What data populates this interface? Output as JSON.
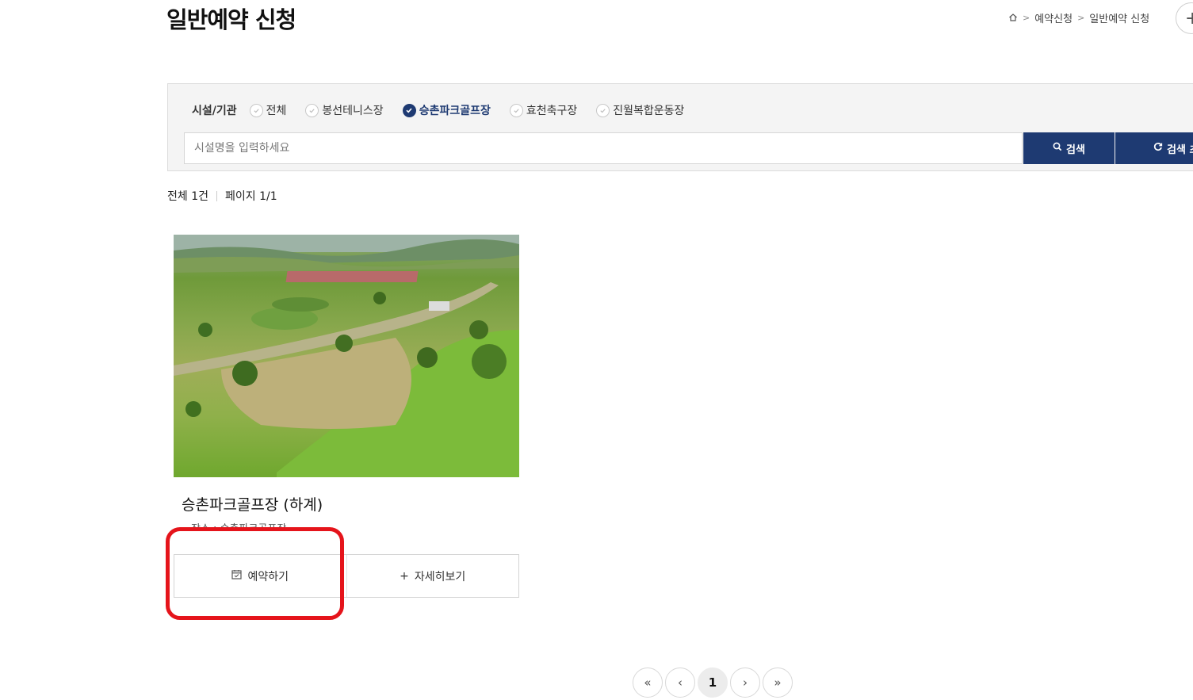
{
  "page": {
    "title": "일반예약 신청"
  },
  "breadcrumb": {
    "home_icon": "home-icon",
    "items": [
      "예약신청",
      "일반예약 신청"
    ],
    "separator": ">"
  },
  "header_action": {
    "icon": "plus-icon",
    "glyph": "+"
  },
  "filter": {
    "label": "시설/기관",
    "options": [
      "전체",
      "봉선테니스장",
      "승촌파크골프장",
      "효천축구장",
      "진월복합운동장"
    ],
    "selected": "승촌파크골프장"
  },
  "search": {
    "placeholder": "시설명을 입력하세요",
    "value": "",
    "search_button": "검색",
    "reset_button": "검색 초기화"
  },
  "result": {
    "total": "전체 1건",
    "page": "페이지 1/1"
  },
  "card": {
    "title": "승촌파크골프장 (하계)",
    "place": "장소 : 승촌파크골프장",
    "reserve_button": "예약하기",
    "detail_button": "자세히보기",
    "detail_glyph": "+"
  },
  "pagination": {
    "first": "«",
    "prev": "‹",
    "current": "1",
    "next": "›",
    "last": "»"
  },
  "colors": {
    "primary": "#1e3a72",
    "highlight": "#e5141b",
    "panel_bg": "#f4f4f4"
  }
}
